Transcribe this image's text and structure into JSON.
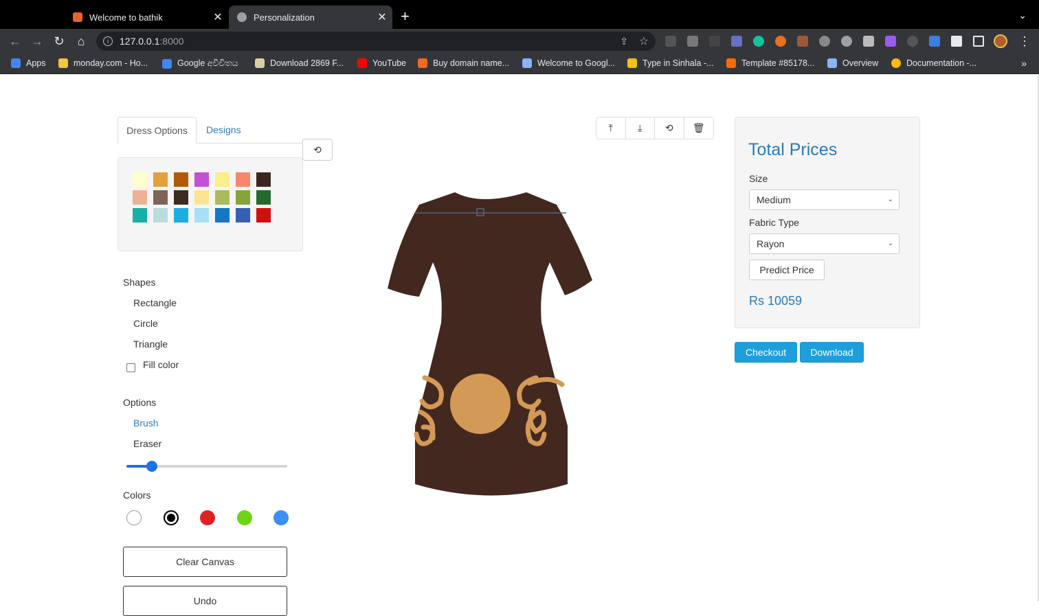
{
  "browser": {
    "tabs": [
      {
        "title": "Welcome to bathik",
        "favicon_color": "#e8632b",
        "active": false
      },
      {
        "title": "Personalization",
        "favicon_color": "#9aa0a6",
        "active": true
      }
    ],
    "new_tab_symbol": "+",
    "close_symbol": "✕",
    "tabs_menu_symbol": "⌄",
    "url_host": "127.0.0.1",
    "url_port": ":8000",
    "icons": {
      "back": "←",
      "forward": "→",
      "reload": "↻",
      "home": "⌂",
      "info": "i",
      "share": "⇪",
      "star": "☆",
      "menu": "⋮",
      "more": "»"
    },
    "bookmarks": [
      {
        "label": "Apps",
        "icon_color": "#4285f4"
      },
      {
        "label": "monday.com - Ho...",
        "icon_color": "#f6c343"
      },
      {
        "label": "Google අවිචිතය",
        "icon_color": "#4285f4"
      },
      {
        "label": "Download 2869 F...",
        "icon_color": "#d8cfa5"
      },
      {
        "label": "YouTube",
        "icon_color": "#ff0000"
      },
      {
        "label": "Buy domain name...",
        "icon_color": "#f26a25"
      },
      {
        "label": "Welcome to Googl...",
        "icon_color": "#8ab4f8"
      },
      {
        "label": "Type in Sinhala -...",
        "icon_color": "#f4c20d"
      },
      {
        "label": "Template #85178...",
        "icon_color": "#ff6a00"
      },
      {
        "label": "Overview",
        "icon_color": "#8ab4f8"
      },
      {
        "label": "Documentation -...",
        "icon_color": "#fbbc04"
      }
    ]
  },
  "left_panel": {
    "tabs": [
      "Dress Options",
      "Designs"
    ],
    "reset_icon": "⟲",
    "swatches": [
      "#ffffcc",
      "#e3a13b",
      "#b25a06",
      "#c64fd6",
      "#faef8c",
      "#f9866a",
      "#3d2621",
      "#edb196",
      "#7f6356",
      "#3d2b20",
      "#fbe592",
      "#abbb5c",
      "#87a43a",
      "#226b2d",
      "#17b0a4",
      "#b9dddc",
      "#1baee4",
      "#a5dff8",
      "#1477c6",
      "#3660b5",
      "#d20f0f"
    ],
    "shapes": {
      "heading": "Shapes",
      "items": [
        "Rectangle",
        "Circle",
        "Triangle"
      ],
      "fill_label": "Fill color"
    },
    "options": {
      "heading": "Options",
      "items": [
        "Brush",
        "Eraser"
      ],
      "brush_size": 0.16
    },
    "colors": {
      "heading": "Colors",
      "items": [
        "#ffffff",
        "#000000",
        "#e02121",
        "#6cd414",
        "#3d8ef5"
      ],
      "selected": 1
    },
    "clear_label": "Clear Canvas",
    "undo_label": "Undo"
  },
  "canvas": {
    "toolbar_icons": [
      "⤒",
      "⤓",
      "⟲",
      "🗑"
    ],
    "dress_color": "#432820",
    "pattern_color": "#d39a57"
  },
  "price_panel": {
    "title": "Total Prices",
    "size_label": "Size",
    "size_value": "Medium",
    "fabric_label": "Fabric Type",
    "fabric_value": "Rayon",
    "predict_label": "Predict Price",
    "price": "Rs 10059",
    "caret": "⌄"
  },
  "actions": {
    "checkout": "Checkout",
    "download": "Download"
  }
}
